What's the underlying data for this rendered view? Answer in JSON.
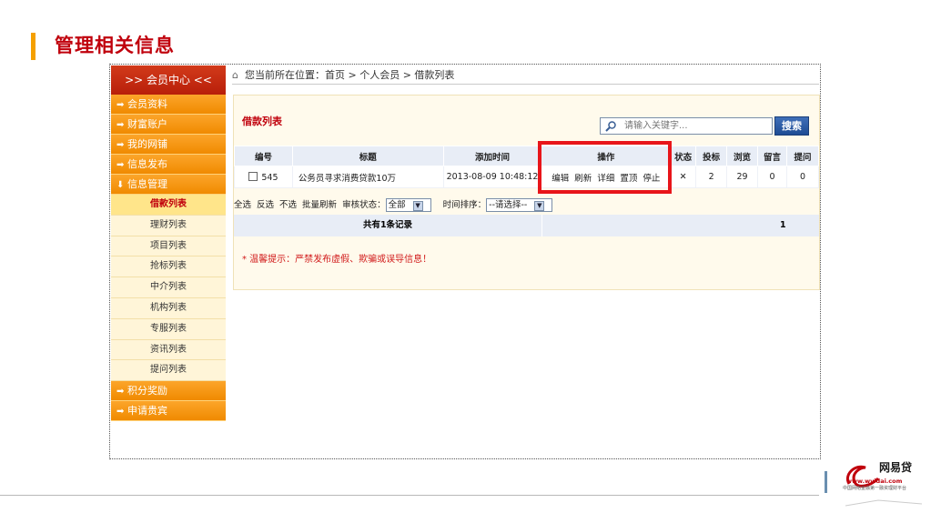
{
  "slide": {
    "title": "管理相关信息"
  },
  "sidebar": {
    "header": ">> 会员中心 <<",
    "categories_top": [
      {
        "label": "会员资料",
        "arrow": "➡"
      },
      {
        "label": "财富账户",
        "arrow": "➡"
      },
      {
        "label": "我的网铺",
        "arrow": "➡"
      },
      {
        "label": "信息发布",
        "arrow": "➡"
      },
      {
        "label": "信息管理",
        "arrow": "⬇"
      }
    ],
    "subitems": [
      "借款列表",
      "理财列表",
      "项目列表",
      "抢标列表",
      "中介列表",
      "机构列表",
      "专服列表",
      "资讯列表",
      "提问列表"
    ],
    "active_subitem": "借款列表",
    "categories_bottom": [
      {
        "label": "积分奖励",
        "arrow": "➡"
      },
      {
        "label": "申请贵宾",
        "arrow": "➡"
      }
    ]
  },
  "breadcrumb": {
    "text": "您当前所在位置：首页 > 个人会员 > 借款列表"
  },
  "panel": {
    "title": "借款列表",
    "search_placeholder": "请输入关键字...",
    "search_button": "搜索"
  },
  "table": {
    "headers": [
      "编号",
      "标题",
      "添加时间",
      "操作",
      "状态",
      "投标",
      "浏览",
      "留言",
      "提问"
    ],
    "rows": [
      {
        "id": "545",
        "title": "公务员寻求消费贷款10万",
        "time": "2013-08-09 10:48:12",
        "ops": [
          "编辑",
          "刷新",
          "详细",
          "置顶",
          "停止"
        ],
        "status": "✕",
        "bids": "2",
        "views": "29",
        "messages": "0",
        "questions": "0"
      }
    ]
  },
  "bulk": {
    "select_all": "全选",
    "invert": "反选",
    "none": "不选",
    "refresh": "批量刷新",
    "review_label": "审核状态：",
    "review_value": "全部",
    "sort_label": "时间排序：",
    "sort_value": "--请选择--"
  },
  "summary": {
    "total": "共有1条记录",
    "page": "1"
  },
  "tip": "* 温馨提示：严禁发布虚假、欺骗或误导信息！",
  "logo": {
    "name": "网易贷",
    "url": "www.wyidai.com",
    "sub1": "中国网络金融第一融资理财平台"
  },
  "colors": {
    "title": "#c0000c",
    "accent": "#f5a000",
    "sidebar_cat": "#f08a00",
    "highlight": "#e8151a",
    "search_btn": "#1e4b94"
  }
}
